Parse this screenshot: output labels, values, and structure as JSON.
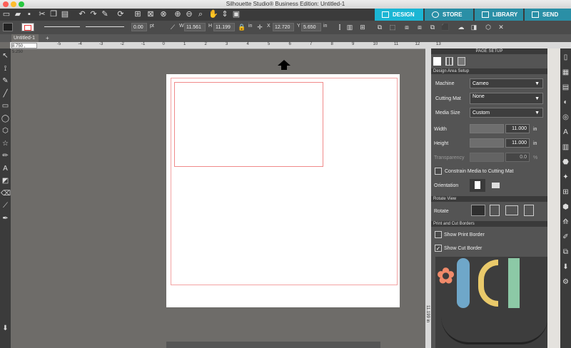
{
  "window": {
    "title": "Silhouette Studio® Business Edition: Untitled-1"
  },
  "nav": {
    "design": "DESIGN",
    "store": "STORE",
    "library": "LIBRARY",
    "send": "SEND",
    "active_color": "#1bb6d4"
  },
  "toolbar": {
    "line_width": "0.00",
    "line_unit": "pt",
    "w_label": "W",
    "w_value": "11.561",
    "h_label": "H",
    "h_value": "11.199",
    "w_unit": "in",
    "x_label": "X",
    "x_value": "12.720",
    "y_label": "Y",
    "y_value": "5.650",
    "y_unit": "in"
  },
  "document": {
    "tab_label": "Untitled-1",
    "add_tab": "+",
    "cursor_coords": "8.750 , 5.250"
  },
  "ruler": {
    "ticks": [
      "-5",
      "-4",
      "-3",
      "-2",
      "-1",
      "0",
      "1",
      "2",
      "3",
      "4",
      "5",
      "6",
      "7",
      "8",
      "9",
      "10",
      "11",
      "12",
      "13"
    ],
    "vertical_label": "11.199 in"
  },
  "page_setup": {
    "title": "PAGE SETUP",
    "design_area_header": "Design Area Setup",
    "machine_label": "Machine",
    "machine_value": "Cameo",
    "cutting_mat_label": "Cutting Mat",
    "cutting_mat_value": "None",
    "media_size_label": "Media Size",
    "media_size_value": "Custom",
    "width_label": "Width",
    "width_value": "11.000",
    "width_unit": "in",
    "height_label": "Height",
    "height_value": "11.000",
    "height_unit": "in",
    "transparency_label": "Transparency",
    "transparency_value": "0.0",
    "transparency_unit": "%",
    "constrain_label": "Constrain Media to Cutting Mat",
    "orientation_label": "Orientation",
    "rotate_view_header": "Rotate View",
    "rotate_label": "Rotate",
    "print_cut_header": "Print and Cut Borders",
    "show_print_border": "Show Print Border",
    "show_cut_border": "Show Cut Border",
    "show_cut_border_checked": true
  },
  "icons": {
    "left_tools": [
      "select-icon",
      "node-edit-icon",
      "freehand-select-icon",
      "line-icon",
      "rectangle-icon",
      "ellipse-icon",
      "polygon-icon",
      "star-icon",
      "pencil-icon",
      "text-icon",
      "fill-icon",
      "eraser-icon",
      "knife-icon",
      "eyedropper-icon"
    ],
    "right_panel": [
      "page-setup-icon",
      "grid-icon",
      "library-icon",
      "fill-panel-icon",
      "line-panel-icon",
      "text-style-icon",
      "replicate-icon",
      "offset-icon",
      "trace-icon",
      "transform-icon",
      "modify-icon",
      "sketch-icon",
      "puzzle-icon",
      "layers-icon",
      "send-icon",
      "settings-icon"
    ]
  }
}
